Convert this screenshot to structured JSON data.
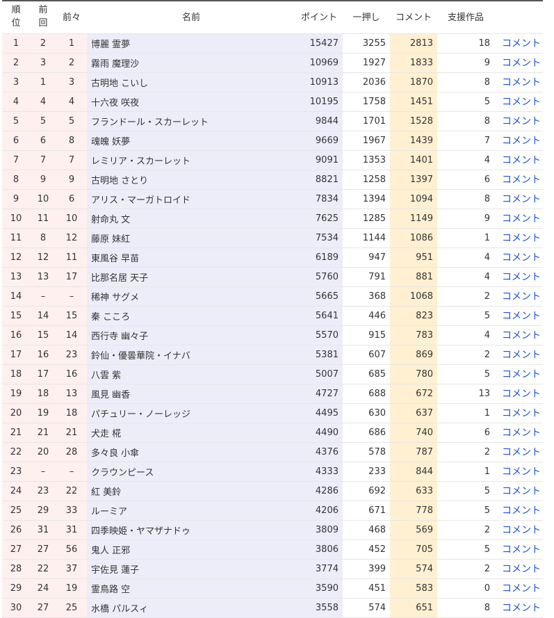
{
  "headers": {
    "rank": [
      "順",
      "位"
    ],
    "prev": [
      "前",
      "回"
    ],
    "prev2": "前々",
    "name": "名前",
    "points": "ポイント",
    "push": "一押し",
    "comment": "コメント",
    "works": "支援作品"
  },
  "colors": {
    "pink": "#fff0f0",
    "lavender": "#ededfa",
    "peach": "#fff0d2",
    "link": "#1a53d8"
  },
  "rows": [
    {
      "rank": "1",
      "prev": "2",
      "prev2": "1",
      "name": "博麗 霊夢",
      "points": "15427",
      "push": "3255",
      "comments": "2813",
      "works": "18",
      "link": "コメント"
    },
    {
      "rank": "2",
      "prev": "3",
      "prev2": "2",
      "name": "霧雨 魔理沙",
      "points": "10969",
      "push": "1927",
      "comments": "1833",
      "works": "9",
      "link": "コメント"
    },
    {
      "rank": "3",
      "prev": "1",
      "prev2": "3",
      "name": "古明地 こいし",
      "points": "10913",
      "push": "2036",
      "comments": "1870",
      "works": "8",
      "link": "コメント"
    },
    {
      "rank": "4",
      "prev": "4",
      "prev2": "4",
      "name": "十六夜 咲夜",
      "points": "10195",
      "push": "1758",
      "comments": "1451",
      "works": "5",
      "link": "コメント"
    },
    {
      "rank": "5",
      "prev": "5",
      "prev2": "5",
      "name": "フランドール・スカーレット",
      "points": "9844",
      "push": "1701",
      "comments": "1528",
      "works": "8",
      "link": "コメント"
    },
    {
      "rank": "6",
      "prev": "6",
      "prev2": "8",
      "name": "魂魄 妖夢",
      "points": "9669",
      "push": "1967",
      "comments": "1439",
      "works": "7",
      "link": "コメント"
    },
    {
      "rank": "7",
      "prev": "7",
      "prev2": "7",
      "name": "レミリア・スカーレット",
      "points": "9091",
      "push": "1353",
      "comments": "1401",
      "works": "4",
      "link": "コメント"
    },
    {
      "rank": "8",
      "prev": "9",
      "prev2": "9",
      "name": "古明地 さとり",
      "points": "8821",
      "push": "1258",
      "comments": "1397",
      "works": "6",
      "link": "コメント"
    },
    {
      "rank": "9",
      "prev": "10",
      "prev2": "6",
      "name": "アリス・マーガトロイド",
      "points": "7834",
      "push": "1394",
      "comments": "1094",
      "works": "8",
      "link": "コメント"
    },
    {
      "rank": "10",
      "prev": "11",
      "prev2": "10",
      "name": "射命丸 文",
      "points": "7625",
      "push": "1285",
      "comments": "1149",
      "works": "9",
      "link": "コメント"
    },
    {
      "rank": "11",
      "prev": "8",
      "prev2": "12",
      "name": "藤原 妹紅",
      "points": "7534",
      "push": "1144",
      "comments": "1086",
      "works": "1",
      "link": "コメント"
    },
    {
      "rank": "12",
      "prev": "12",
      "prev2": "11",
      "name": "東風谷 早苗",
      "points": "6189",
      "push": "947",
      "comments": "951",
      "works": "4",
      "link": "コメント"
    },
    {
      "rank": "13",
      "prev": "13",
      "prev2": "17",
      "name": "比那名居 天子",
      "points": "5760",
      "push": "791",
      "comments": "881",
      "works": "4",
      "link": "コメント"
    },
    {
      "rank": "14",
      "prev": "–",
      "prev2": "–",
      "name": "稀神 サグメ",
      "points": "5665",
      "push": "368",
      "comments": "1068",
      "works": "2",
      "link": "コメント"
    },
    {
      "rank": "15",
      "prev": "14",
      "prev2": "15",
      "name": "秦 こころ",
      "points": "5641",
      "push": "446",
      "comments": "823",
      "works": "5",
      "link": "コメント"
    },
    {
      "rank": "16",
      "prev": "15",
      "prev2": "14",
      "name": "西行寺 幽々子",
      "points": "5570",
      "push": "915",
      "comments": "783",
      "works": "4",
      "link": "コメント"
    },
    {
      "rank": "17",
      "prev": "16",
      "prev2": "23",
      "name": "鈴仙・優曇華院・イナバ",
      "points": "5381",
      "push": "607",
      "comments": "869",
      "works": "2",
      "link": "コメント"
    },
    {
      "rank": "18",
      "prev": "17",
      "prev2": "16",
      "name": "八雲 紫",
      "points": "5007",
      "push": "685",
      "comments": "780",
      "works": "5",
      "link": "コメント"
    },
    {
      "rank": "19",
      "prev": "18",
      "prev2": "13",
      "name": "風見 幽香",
      "points": "4727",
      "push": "688",
      "comments": "672",
      "works": "13",
      "link": "コメント"
    },
    {
      "rank": "20",
      "prev": "19",
      "prev2": "18",
      "name": "パチュリー・ノーレッジ",
      "points": "4495",
      "push": "630",
      "comments": "637",
      "works": "1",
      "link": "コメント"
    },
    {
      "rank": "21",
      "prev": "21",
      "prev2": "21",
      "name": "犬走 椛",
      "points": "4490",
      "push": "686",
      "comments": "740",
      "works": "6",
      "link": "コメント"
    },
    {
      "rank": "22",
      "prev": "20",
      "prev2": "28",
      "name": "多々良 小傘",
      "points": "4376",
      "push": "578",
      "comments": "787",
      "works": "2",
      "link": "コメント"
    },
    {
      "rank": "23",
      "prev": "–",
      "prev2": "–",
      "name": "クラウンピース",
      "points": "4333",
      "push": "233",
      "comments": "844",
      "works": "1",
      "link": "コメント"
    },
    {
      "rank": "24",
      "prev": "23",
      "prev2": "22",
      "name": "紅 美鈴",
      "points": "4286",
      "push": "692",
      "comments": "633",
      "works": "5",
      "link": "コメント"
    },
    {
      "rank": "25",
      "prev": "29",
      "prev2": "33",
      "name": "ルーミア",
      "points": "4206",
      "push": "671",
      "comments": "778",
      "works": "5",
      "link": "コメント"
    },
    {
      "rank": "26",
      "prev": "31",
      "prev2": "31",
      "name": "四季映姫・ヤマザナドゥ",
      "points": "3809",
      "push": "468",
      "comments": "569",
      "works": "2",
      "link": "コメント"
    },
    {
      "rank": "27",
      "prev": "27",
      "prev2": "56",
      "name": "鬼人 正邪",
      "points": "3806",
      "push": "452",
      "comments": "705",
      "works": "5",
      "link": "コメント"
    },
    {
      "rank": "28",
      "prev": "22",
      "prev2": "37",
      "name": "宇佐見 蓮子",
      "points": "3774",
      "push": "399",
      "comments": "574",
      "works": "2",
      "link": "コメント"
    },
    {
      "rank": "29",
      "prev": "24",
      "prev2": "19",
      "name": "霊鳥路 空",
      "points": "3590",
      "push": "451",
      "comments": "583",
      "works": "0",
      "link": "コメント"
    },
    {
      "rank": "30",
      "prev": "27",
      "prev2": "25",
      "name": "水橋 パルスィ",
      "points": "3558",
      "push": "574",
      "comments": "651",
      "works": "8",
      "link": "コメント"
    }
  ]
}
